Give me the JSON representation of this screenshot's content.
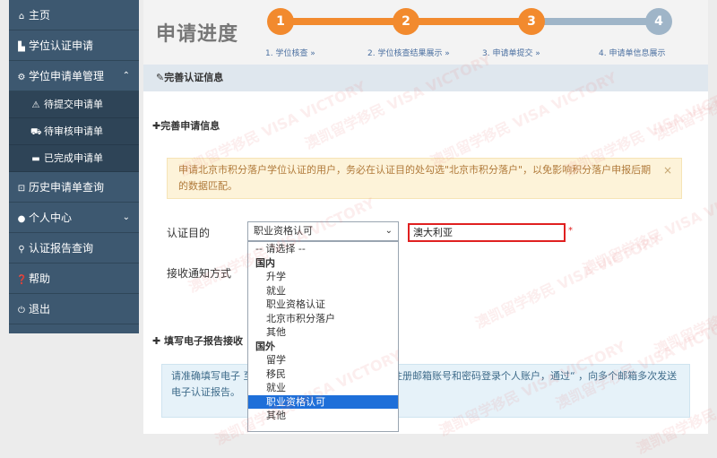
{
  "sidebar": {
    "items": [
      {
        "icon": "home-icon",
        "glyph": "⌂",
        "label": "主页"
      },
      {
        "icon": "document-icon",
        "glyph": "▙",
        "label": "学位认证申请"
      },
      {
        "icon": "gear-icon",
        "glyph": "⚙",
        "label": "学位申请单管理",
        "caret": "⌃"
      }
    ],
    "subitems": [
      {
        "icon": "warning-icon",
        "glyph": "⚠",
        "label": "待提交申请单"
      },
      {
        "icon": "cart-icon",
        "glyph": "⛟",
        "label": "待审核申请单"
      },
      {
        "icon": "briefcase-icon",
        "glyph": "▬",
        "label": "已完成申请单"
      }
    ],
    "items2": [
      {
        "icon": "history-icon",
        "glyph": "⊡",
        "label": "历史申请单查询"
      },
      {
        "icon": "user-icon",
        "glyph": "●",
        "label": "个人中心",
        "caret": "⌄"
      },
      {
        "icon": "search-icon",
        "glyph": "⚲",
        "label": "认证报告查询"
      },
      {
        "icon": "help-icon",
        "glyph": "❓",
        "label": "帮助"
      },
      {
        "icon": "power-icon",
        "glyph": "⏻",
        "label": "退出"
      }
    ]
  },
  "progress": {
    "title": "申请进度",
    "steps": [
      {
        "num": "1",
        "label": "1. 学位核查    »"
      },
      {
        "num": "2",
        "label": "2. 学位核查结果展示    »"
      },
      {
        "num": "3",
        "label": "3. 申请单提交    »"
      },
      {
        "num": "4",
        "label": "4. 申请单信息展示"
      }
    ],
    "colors": {
      "done": "#f28a2e",
      "todo": "#9fb5c8"
    }
  },
  "section": {
    "header": "✎完善认证信息",
    "sub1": "✚完善申请信息",
    "alert": "申请北京市积分落户学位认证的用户，务必在认证目的处勾选\"北京市积分落户\"，以免影响积分落户申报后期的数据匹配。",
    "alert_close": "×",
    "purpose_label": "认证目的",
    "select_value": "职业资格认可",
    "select_arrow": "⌄",
    "country_value": "澳大利亚",
    "required_mark": "*",
    "notify_label": "接收通知方式",
    "sub2": "✚ 填写电子报告接收",
    "info": "请准确填写电子                                        至3个邮箱），后期如有需要，可凭注册邮箱账号和密码登录个人账户，通过“                              ，向多个邮箱多次发送电子认证报告。"
  },
  "dropdown": [
    {
      "type": "placeholder",
      "label": "-- 请选择 --"
    },
    {
      "type": "group",
      "label": "国内"
    },
    {
      "type": "option",
      "label": "升学"
    },
    {
      "type": "option",
      "label": "就业"
    },
    {
      "type": "option",
      "label": "职业资格认证"
    },
    {
      "type": "option",
      "label": "北京市积分落户"
    },
    {
      "type": "option",
      "label": "其他"
    },
    {
      "type": "group",
      "label": "国外"
    },
    {
      "type": "option",
      "label": "留学"
    },
    {
      "type": "option",
      "label": "移民"
    },
    {
      "type": "option",
      "label": "就业"
    },
    {
      "type": "option",
      "label": "职业资格认可",
      "selected": true
    },
    {
      "type": "option",
      "label": "其他"
    }
  ],
  "watermark": "澳凯留学移民 VISA VICTORY"
}
